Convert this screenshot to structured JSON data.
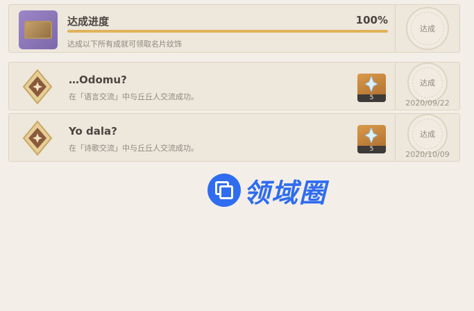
{
  "progress": {
    "title": "达成进度",
    "percent_label": "100%",
    "fill_fraction": 1.0,
    "description": "达成以下所有成就可领取名片纹饰",
    "stamp_text": "达成"
  },
  "achievements": [
    {
      "title": "…Odomu?",
      "description": "在「语言交流」中与丘丘人交流成功。",
      "reward_quantity": "5",
      "stamp_text": "达成",
      "date": "2020/09/22"
    },
    {
      "title": "Yo dala?",
      "description": "在「诗歌交流」中与丘丘人交流成功。",
      "reward_quantity": "5",
      "stamp_text": "达成",
      "date": "2020/10/09"
    }
  ],
  "watermark": {
    "text": "领域圈"
  },
  "colors": {
    "background": "#f3efe8",
    "progress_fill": "#e2b25a",
    "watermark_blue": "#2f6cf0"
  },
  "icons": {
    "namecard": "namecard-icon",
    "medal": "achievement-medal-icon",
    "reward": "primogem-icon",
    "watermark": "watermark-logo-icon"
  }
}
